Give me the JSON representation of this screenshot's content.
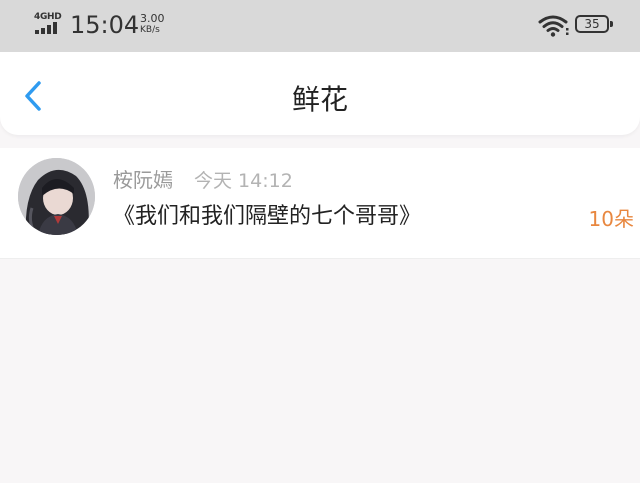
{
  "status_bar": {
    "network": "4GHD",
    "time": "15:04",
    "speed_value": "3.00",
    "speed_unit": "KB/s",
    "battery": "35",
    "icons": [
      "signal-icon",
      "wifi-icon",
      "battery-icon"
    ]
  },
  "header": {
    "back_icon": "chevron-left-icon",
    "title": "鲜花"
  },
  "records": [
    {
      "avatar": "user-avatar",
      "username": "桉阮嫣",
      "timestamp": "今天 14:12",
      "book_title": "《我们和我们隔壁的七个哥哥》",
      "amount": "10朵"
    }
  ],
  "colors": {
    "status_bar_bg": "#d9d9d9",
    "accent_blue": "#2f9bf0",
    "amount_orange": "#e8873f",
    "page_bg": "#f8f6f7"
  }
}
